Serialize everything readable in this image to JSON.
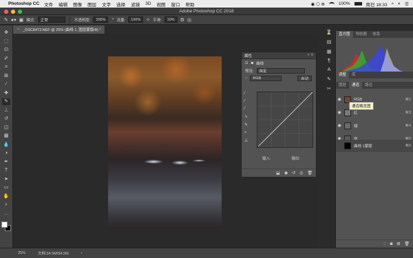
{
  "menubar": {
    "app": "Photoshop CC",
    "items": [
      "文件",
      "编辑",
      "图像",
      "图层",
      "文字",
      "选择",
      "滤镜",
      "3D",
      "视图",
      "窗口",
      "帮助"
    ],
    "battery": "100%",
    "clock": "周日 18:33"
  },
  "window": {
    "title": "Adobe Photoshop CC 2018"
  },
  "options": {
    "mode_label": "模式:",
    "mode_value": "正常",
    "opacity_label": "不透明度:",
    "opacity_value": "100%",
    "flow_label": "流量:",
    "flow_value": "100%",
    "smooth_label": "平滑:",
    "smooth_value": "10%"
  },
  "document": {
    "tab": "_DSC8473.NEF @ 25% (曲线 1, 图层蒙版/8) *"
  },
  "properties": {
    "title": "属性",
    "type": "曲线",
    "preset_label": "预设:",
    "preset_value": "自定",
    "channel_value": "RGB",
    "auto_label": "自动",
    "input_label": "输入:",
    "output_label": "输出:",
    "curve_points": [
      [
        0,
        0
      ],
      [
        255,
        255
      ]
    ]
  },
  "histogram": {
    "tabs": [
      "直方图",
      "导航器",
      "信息"
    ]
  },
  "adjustments": {
    "tabs": [
      "调整",
      "库"
    ]
  },
  "layers": {
    "tabs": [
      "图层",
      "通道",
      "路径"
    ],
    "channels": [
      {
        "name": "RGB",
        "shortcut": "⌘2"
      },
      {
        "name": "红",
        "shortcut": "⌘3"
      },
      {
        "name": "绿",
        "shortcut": "⌘4"
      },
      {
        "name": "蓝",
        "shortcut": "⌘5"
      },
      {
        "name": "曲线 1蒙版",
        "shortcut": "⌘6"
      }
    ],
    "tooltip": "通道略览图"
  },
  "status": {
    "zoom": "25%",
    "doc_size": "文档:34.5M/34.5M"
  },
  "colors": {
    "foreground": "#ffffff",
    "background": "#000000"
  }
}
